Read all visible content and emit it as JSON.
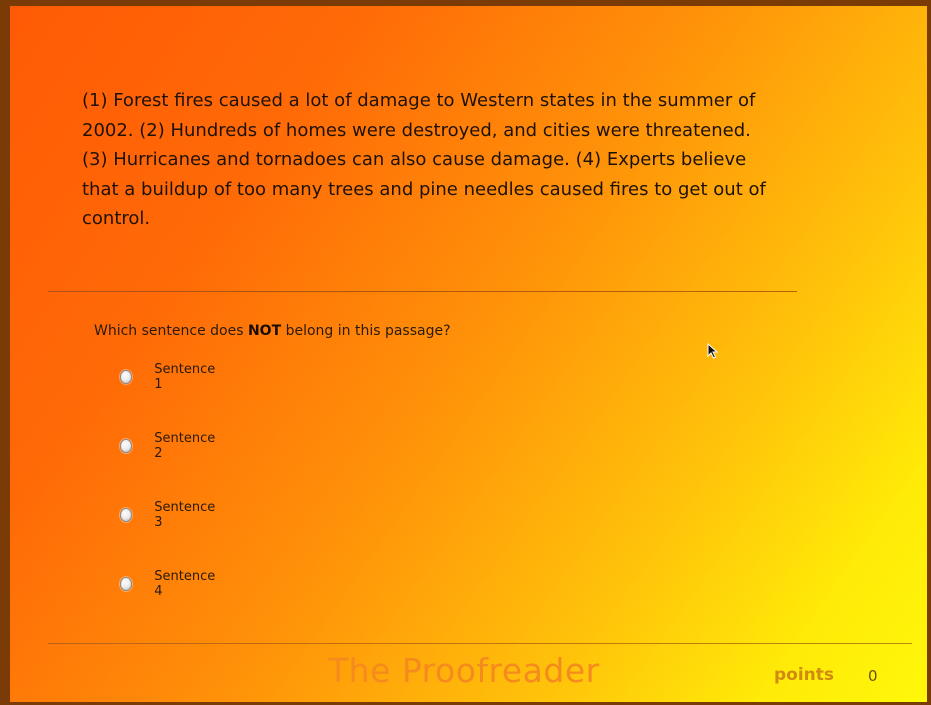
{
  "passage": {
    "text": "(1) Forest fires caused a lot of damage to Western states in the summer of 2002. (2) Hundreds of homes were destroyed, and cities were threatened. (3) Hurricanes and tornadoes can also cause damage. (4) Experts believe that a buildup of too many trees and pine needles caused fires to get out of control."
  },
  "question": {
    "prefix": "Which sentence does ",
    "emphasis": "NOT",
    "suffix": " belong in this passage?"
  },
  "options": [
    {
      "label": "Sentence 1",
      "selected": false
    },
    {
      "label": "Sentence 2",
      "selected": false
    },
    {
      "label": "Sentence 3",
      "selected": false
    },
    {
      "label": "Sentence 4",
      "selected": false
    }
  ],
  "footer": {
    "app_title": "The Proofreader",
    "points_label": "points",
    "points_value": "0"
  },
  "colors": {
    "gradient_start": "#ff5a06",
    "gradient_end": "#fff80a",
    "frame_border": "#7a3b06",
    "title_color": "#f58a1e",
    "points_color": "#d18a10"
  },
  "icons": {
    "cursor": "arrow-cursor-icon",
    "radio": "radio-button-icon"
  }
}
